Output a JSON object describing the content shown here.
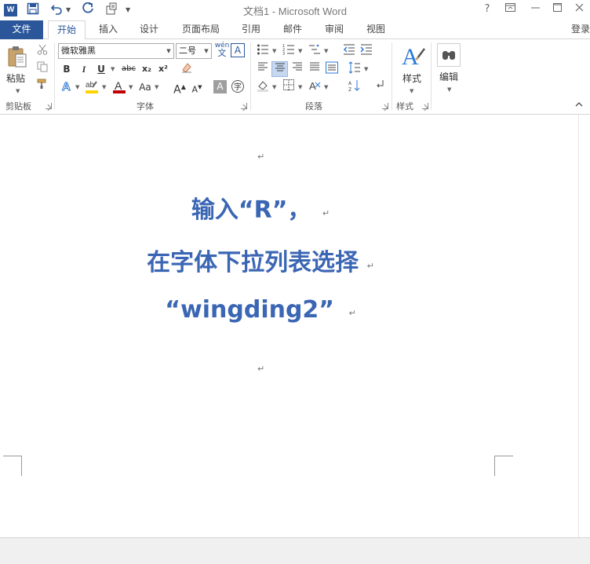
{
  "window": {
    "title": "文档1 - Microsoft Word",
    "help": "?",
    "login": "登录"
  },
  "tabs": [
    {
      "label": "文件"
    },
    {
      "label": "开始"
    },
    {
      "label": "插入"
    },
    {
      "label": "设计"
    },
    {
      "label": "页面布局"
    },
    {
      "label": "引用"
    },
    {
      "label": "邮件"
    },
    {
      "label": "审阅"
    },
    {
      "label": "视图"
    }
  ],
  "ribbon": {
    "clipboard": {
      "paste_label": "粘贴",
      "group_label": "剪贴板"
    },
    "font": {
      "font_name": "微软雅黑",
      "font_size": "二号",
      "bold": "B",
      "italic": "I",
      "underline": "U",
      "strike": "abc",
      "subscript": "x₂",
      "superscript": "x²",
      "grow": "A",
      "shrink": "A",
      "change_case": "Aa",
      "char_shade": "A",
      "enclose": "字",
      "phonetic": "wén",
      "phonetic_sub": "文",
      "group_label": "字体"
    },
    "paragraph": {
      "group_label": "段落"
    },
    "styles": {
      "label": "样式",
      "group_label": "样式"
    },
    "editing": {
      "label": "编辑"
    }
  },
  "document": {
    "lines": [
      "输入“R”，",
      "在字体下拉列表选择",
      "“wingding2”"
    ],
    "paragraph_mark": "↵"
  },
  "colors": {
    "accent": "#2b579a",
    "text_blue": "#3b66b4"
  }
}
